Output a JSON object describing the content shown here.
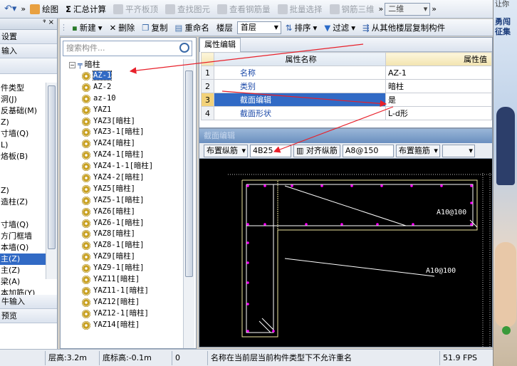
{
  "toolbar": {
    "undo_label": "",
    "items": [
      {
        "label": "绘图",
        "enabled": true
      },
      {
        "label": "汇总计算",
        "enabled": true
      },
      {
        "label": "平齐板顶",
        "enabled": false
      },
      {
        "label": "查找图元",
        "enabled": false
      },
      {
        "label": "查看钢筋量",
        "enabled": false
      },
      {
        "label": "批量选择",
        "enabled": false
      },
      {
        "label": "钢筋三维",
        "enabled": false
      }
    ],
    "view_combo": "二维"
  },
  "ad": {
    "line1": "让你",
    "line2": "勇闯",
    "line3": "征集"
  },
  "left_panel": {
    "pin": "ᵠ ×",
    "row1": "设置",
    "row2": "输入",
    "items": [
      "件类型",
      "洞(J)",
      "反基础(M)",
      "Z)",
      "寸墙(Q)",
      "L)",
      "烙板(B)",
      "",
      "",
      "Z)",
      "造柱(Z)",
      "",
      "寸墙(Q)",
      "方门框墙",
      "本墙(Q)",
      "主(Z)",
      "主(Z)",
      "梁(A)",
      "本加筋(Y)"
    ],
    "selected_index": 15,
    "bottom1": "牛输入",
    "bottom2": "预览"
  },
  "secondbar": {
    "new": "新建",
    "delete": "删除",
    "copy": "复制",
    "rename": "重命名",
    "floor_label": "楼层",
    "floor_value": "首层",
    "sort": "排序",
    "filter": "过滤",
    "copy_from_floor": "从其他楼层复制构件"
  },
  "tree": {
    "search_placeholder": "搜索构件...",
    "root": "暗柱",
    "items": [
      "AZ-1",
      "AZ-2",
      "az-10",
      "YAZ1",
      "YAZ3[暗柱]",
      "YAZ3-1[暗柱]",
      "YAZ4[暗柱]",
      "YAZ4-1[暗柱]",
      "YAZ4-1-1[暗柱]",
      "YAZ4-2[暗柱]",
      "YAZ5[暗柱]",
      "YAZ5-1[暗柱]",
      "YAZ6[暗柱]",
      "YAZ6-1[暗柱]",
      "YAZ8[暗柱]",
      "YAZ8-1[暗柱]",
      "YAZ9[暗柱]",
      "YAZ9-1[暗柱]",
      "YAZ11[暗柱]",
      "YAZ11-1[暗柱]",
      "YAZ12[暗柱]",
      "YAZ12-1[暗柱]",
      "YAZ14[暗柱]"
    ],
    "selected_index": 0
  },
  "props": {
    "tab": "属性编辑",
    "col_name": "属性名称",
    "col_value": "属性值",
    "rows": [
      {
        "idx": "1",
        "name": "名称",
        "value": "AZ-1"
      },
      {
        "idx": "2",
        "name": "类别",
        "value": "暗柱"
      },
      {
        "idx": "3",
        "name": "截面编辑",
        "value": "是"
      },
      {
        "idx": "4",
        "name": "截面形状",
        "value": "L-d形"
      }
    ],
    "selected_index": 2
  },
  "section": {
    "title": "截面编辑",
    "btn_place_long": "布置纵筋",
    "long_value": "4B25",
    "btn_align": "对齐纵筋",
    "stirrup_value": "A8@150",
    "btn_place_stirrup": "布置箍筋",
    "label1": "A10@100",
    "label2": "A10@100"
  },
  "status": {
    "floor_height": "层高:3.2m",
    "bottom_elev": "底标高:-0.1m",
    "zero": "0",
    "message": "名称在当前层当前构件类型下不允许重名",
    "fps": "51.9 FPS"
  },
  "colors": {
    "accent": "#316ac5",
    "annotation": "#e8202a",
    "rebar": "#ff00ff",
    "outline": "#f0e8a0"
  }
}
